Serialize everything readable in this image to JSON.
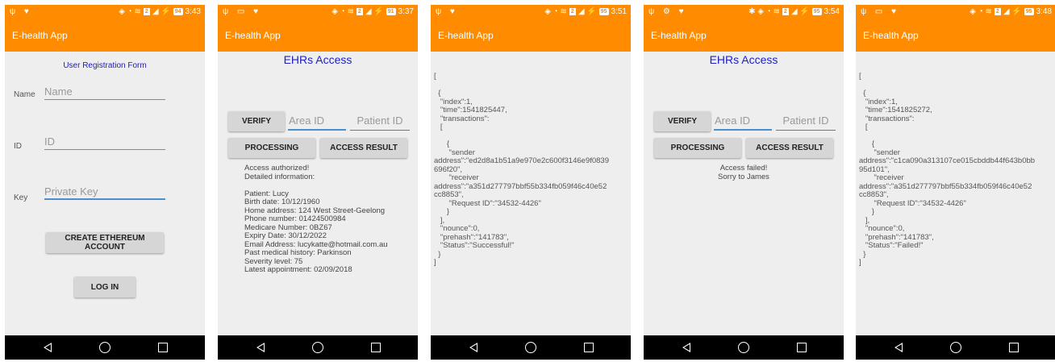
{
  "app_title": "E-health App",
  "screens": [
    {
      "status": {
        "left": "ψ ♥",
        "battery": "94",
        "time": "3:43"
      },
      "form_title": "User Registration Form",
      "fields": [
        {
          "label": "Name",
          "placeholder": "Name"
        },
        {
          "label": "ID",
          "placeholder": "ID"
        },
        {
          "label": "Key",
          "placeholder": "Private Key"
        }
      ],
      "create_button": "CREATE ETHEREUM ACCOUNT",
      "login_button": "LOG IN"
    },
    {
      "status": {
        "left": "ψ ▭ ♥",
        "battery": "91",
        "time": "3:37"
      },
      "title": "EHRs Access",
      "verify_button": "VERIFY",
      "area_placeholder": "Area ID",
      "patient_placeholder": "Patient ID",
      "processing_button": "PROCESSING",
      "access_result_button": "ACCESS RESULT",
      "result_lines": [
        "Access authorized!",
        "Detailed information:",
        "",
        "Patient: Lucy",
        "Birth date: 10/12/1960",
        "Home address: 124 West Street-Geelong",
        "Phone number: 01424500984",
        "Medicare Number:  0BZ67",
        "Expiry Date: 30/12/2022",
        "Email Address: lucykatte@hotmail.com.au",
        "Past medical history: Parkinson",
        "Severity level: 75",
        "Latest appointment: 02/09/2018"
      ]
    },
    {
      "status": {
        "left": "ψ ♥",
        "battery": "95",
        "time": "3:51"
      },
      "json_lines": [
        "[",
        "",
        "  {",
        "   \"index\":1,",
        "   \"time\":1541825447,",
        "   \"transactions\":",
        "   [",
        "",
        "      {",
        "       \"sender",
        "address\":\"ed2d8a1b51a9e970e2c600f3146e9f0839",
        "696f20\",",
        "       \"receiver",
        "address\":\"a351d277797bbf55b334fb059f46c40e52",
        "cc8853\",",
        "       \"Request ID\":\"34532-4426\"",
        "      }",
        "   ],",
        "   \"nounce\":0,",
        "   \"prehash\":\"141783\",",
        "   \"Status\":\"Successful!\"",
        "  }",
        "]"
      ]
    },
    {
      "status": {
        "left": "ψ ⚙ ♥",
        "battery": "95",
        "time": "3:54"
      },
      "title": "EHRs Access",
      "verify_button": "VERIFY",
      "area_placeholder": "Area ID",
      "patient_placeholder": "Patient ID",
      "processing_button": "PROCESSING",
      "access_result_button": "ACCESS RESULT",
      "result_lines": [
        "Access failed!",
        "Sorry to James"
      ]
    },
    {
      "status": {
        "left": "ψ ▭ ♥",
        "battery": "95",
        "time": "3:48"
      },
      "json_lines": [
        "[",
        "",
        "  {",
        "   \"index\":1,",
        "   \"time\":1541825272,",
        "   \"transactions\":",
        "   [",
        "",
        "      {",
        "       \"sender",
        "address\":\"c1ca090a313107ce015cbddb44f643b0bb",
        "95d101\",",
        "       \"receiver",
        "address\":\"a351d277797bbf55b334fb059f46c40e52",
        "cc8853\",",
        "       \"Request ID\":\"34532-4426\"",
        "      }",
        "   ],",
        "   \"nounce\":0,",
        "   \"prehash\":\"141783\",",
        "   \"Status\":\"Failed!\"",
        "  }",
        "]"
      ]
    }
  ]
}
